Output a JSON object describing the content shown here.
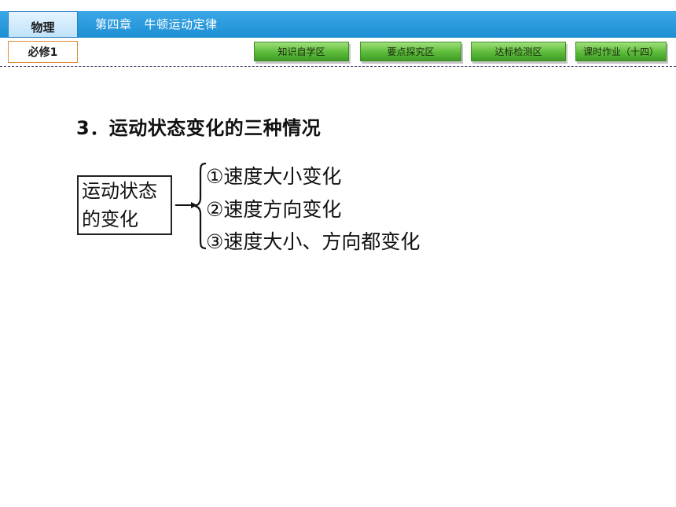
{
  "header": {
    "subject": "物理",
    "chapter_number": "第四章",
    "chapter_name": "牛顿运动定律",
    "volume": "必修1"
  },
  "nav": [
    {
      "label": "知识自学区"
    },
    {
      "label": "要点探究区"
    },
    {
      "label": "达标检测区"
    },
    {
      "label": "课时作业（十四）"
    }
  ],
  "content": {
    "section_title": "3．运动状态变化的三种情况",
    "box_lines": [
      "运动状态",
      "的变化"
    ],
    "cases": [
      "①速度大小变化",
      "②速度方向变化",
      "③速度大小、方向都变化"
    ]
  },
  "colors": {
    "header_blue": "#1e8fd6",
    "nav_green": "#5dbb3a",
    "volume_border": "#e08a3a"
  }
}
